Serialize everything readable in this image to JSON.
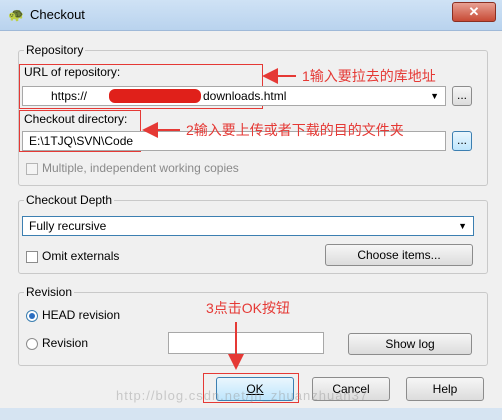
{
  "window": {
    "title": "Checkout",
    "close_glyph": "✕"
  },
  "repository": {
    "group_title": "Repository",
    "url_label": "URL of repository:",
    "url_value_prefix": "https://",
    "url_value_suffix": "downloads.html",
    "browse_label": "...",
    "checkout_dir_label": "Checkout directory:",
    "checkout_dir_value": "E:\\1TJQ\\SVN\\Code",
    "browse_dir_label": "...",
    "multiple_label": "Multiple, independent working copies"
  },
  "depth": {
    "group_title": "Checkout Depth",
    "selected": "Fully recursive",
    "omit_label": "Omit externals",
    "choose_items_label": "Choose items..."
  },
  "revision": {
    "group_title": "Revision",
    "head_label": "HEAD revision",
    "revision_label": "Revision",
    "show_log_label": "Show log"
  },
  "buttons": {
    "ok": "OK",
    "cancel": "Cancel",
    "help": "Help"
  },
  "annotations": {
    "step1": "1输入要拉去的库地址",
    "step2": "2输入要上传或者下载的目的文件夹",
    "step3": "3点击OK按钮"
  },
  "watermark": "http://blog.csdn.net/jn_zhuanzhuan37"
}
